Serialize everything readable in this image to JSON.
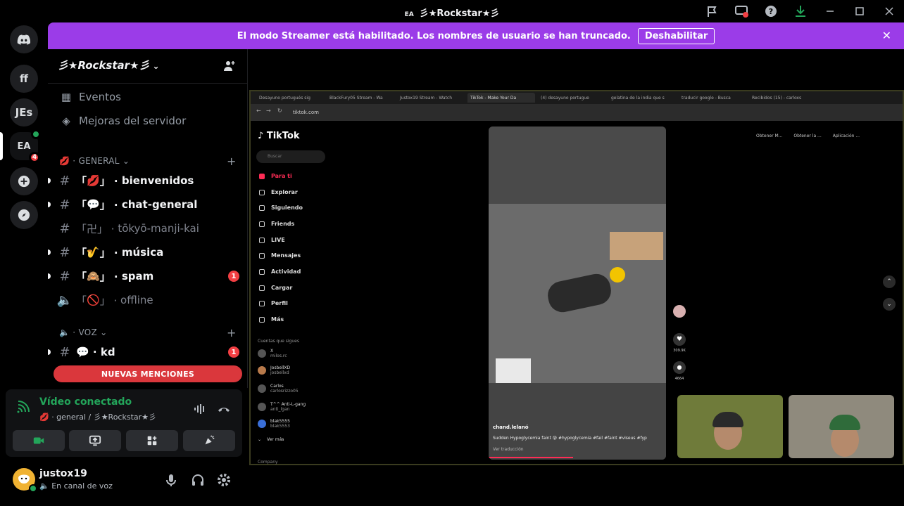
{
  "window": {
    "title": "彡★Rockstar★彡",
    "ea_badge": "EA"
  },
  "rail": {
    "servers": [
      "ff",
      "JEs"
    ],
    "ea_badge_count": "4"
  },
  "banner": {
    "text": "El modo Streamer está habilitado. Los nombres de usuario se han truncado.",
    "button": "Deshabilitar",
    "close": "✕"
  },
  "sidebar": {
    "server_name": "彡★Rockstar★彡",
    "events": "Eventos",
    "boosts": "Mejoras del servidor",
    "category_general": "GENERAL",
    "category_voz": "VOZ",
    "channels": [
      {
        "emoji": "💋",
        "name": "bienvenidos"
      },
      {
        "emoji": "💬",
        "name": "chat-general"
      },
      {
        "emoji": "卍",
        "name": "tōkyō-manji-kai"
      },
      {
        "emoji": "🎷",
        "name": "música"
      },
      {
        "emoji": "🙈",
        "name": "spam",
        "count": "1"
      },
      {
        "emoji": "🚫",
        "name": "offline"
      }
    ],
    "voice_channel": {
      "emoji": "💬",
      "name": "kd",
      "count": "1"
    },
    "mentions_button": "NUEVAS MENCIONES"
  },
  "voice_panel": {
    "status": "Vídeo conectado",
    "location": "💋 · general / 彡★Rockstar★彡"
  },
  "user": {
    "name": "justox19",
    "status": "En canal de voz"
  },
  "browser": {
    "tabs": [
      "Desayuno portugués sig",
      "BlackFury05 Stream - Wa",
      "Justox19 Stream - Watch",
      "TikTok - Make Your Da",
      "(4) desayuno portugue",
      "gelatina de la india que s",
      "traducir google - Busca",
      "Recibidos (15) - carloxs"
    ],
    "url": "tiktok.com"
  },
  "tiktok": {
    "logo": "TikTok",
    "search_placeholder": "Buscar",
    "nav": [
      "Para ti",
      "Explorar",
      "Siguiendo",
      "Friends",
      "LIVE",
      "Mensajes",
      "Actividad",
      "Cargar",
      "Perfil",
      "Más"
    ],
    "following_title": "Cuentas que sigues",
    "following": [
      {
        "name": "X",
        "sub": "milos.rc"
      },
      {
        "name": "JosbellXD",
        "sub": "josbellxd"
      },
      {
        "name": "Carlos",
        "sub": "carlosrizzo05"
      },
      {
        "name": "T^^ Anti-L-gang",
        "sub": "anti_lgan"
      },
      {
        "name": "blak5555",
        "sub": "blak5553"
      }
    ],
    "see_more": "Ver más",
    "footer": "Company",
    "video_user": "chand.lelanó",
    "video_caption": "Sudden Hypoglycemia faint 😰 #hypoglycemia #fail #faint #viseus #fyp",
    "video_translate": "Ver traducción",
    "likes": "309.9K",
    "comments": "4664",
    "top_buttons": [
      "Obtener M...",
      "Obtener la ...",
      "Aplicación ..."
    ]
  }
}
